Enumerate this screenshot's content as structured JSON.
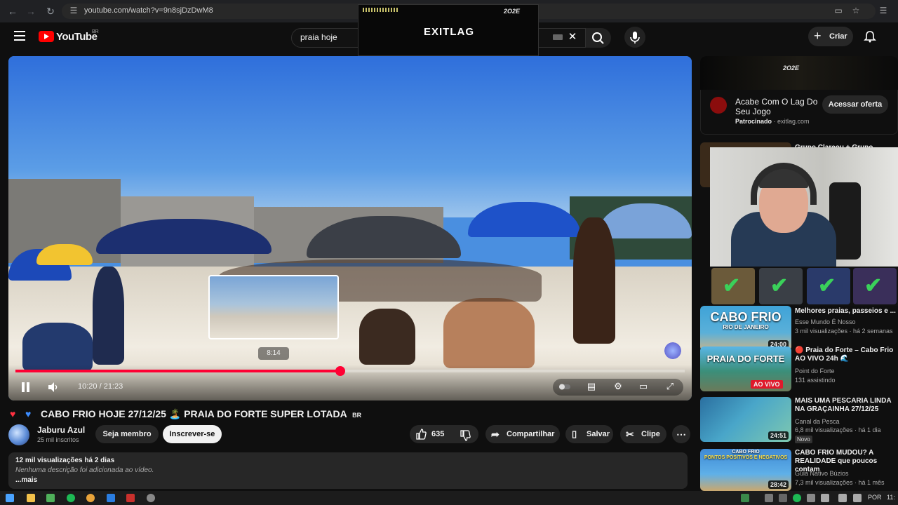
{
  "browser": {
    "url": "youtube.com/watch?v=9n8sjDzDwM8"
  },
  "overlay_ad": {
    "logo_text": "EXITLAG",
    "badge_text": "2O2E"
  },
  "header": {
    "logo_text": "YouTube",
    "country_code": "BR",
    "search_value": "praia hoje",
    "create_label": "Criar"
  },
  "player": {
    "preview_time": "8:14",
    "current_time": "10:20 / 21:23",
    "progress_fraction": 0.485,
    "buffer_fraction": 0.49
  },
  "video": {
    "title": "CABO FRIO HOJE 27/12/25 🏝️ PRAIA DO FORTE SUPER LOTADA",
    "title_suffix": "BR",
    "channel_name": "Jaburu Azul",
    "subscribers": "25 mil inscritos",
    "member_label": "Seja membro",
    "subscribe_label": "Inscrever-se",
    "likes": "635",
    "share_label": "Compartilhar",
    "save_label": "Salvar",
    "clip_label": "Clipe",
    "stats": "12 mil visualizações  há 2 dias",
    "description": "Nenhuma descrição foi adicionada ao vídeo.",
    "more_label": "...mais"
  },
  "sidebar_ad": {
    "banner_badge": "2O2E",
    "title": "Acabe Com O Lag Do Seu Jogo",
    "sponsored": "Patrocinado",
    "domain": "· exitlag.com",
    "cta": "Acessar oferta"
  },
  "recommendations": [
    {
      "title": "Grupo Clareou + Grupo",
      "channel": "",
      "stats": "",
      "duration": "",
      "caption": ""
    },
    {
      "title": "Melhores praias, passeios e ...",
      "channel": "Esse Mundo É Nosso",
      "stats": "3 mil visualizações · há 2 semanas",
      "duration": "24:00",
      "caption": "CABO FRIO",
      "subcaption": "RIO DE JANEIRO"
    },
    {
      "title": "🔴 Praia do Forte – Cabo Frio AO VIVO 24h 🌊",
      "channel": "Point do Forte",
      "stats": "131 assistindo",
      "duration": "",
      "caption": "PRAIA DO FORTE",
      "subcaption": "AO VIVO",
      "live_badge": "AO VIVO"
    },
    {
      "title": "MAIS UMA PESCARIA LINDA NA GRAÇAINHA 27/12/25",
      "channel": "Canal da Pesca",
      "stats": "6,8 mil visualizações · há 1 dia",
      "badge": "Novo",
      "duration": "24:51"
    },
    {
      "title": "CABO FRIO MUDOU? A REALIDADE que poucos contam",
      "channel": "Guia Nativo Búzios",
      "stats": "7,3 mil visualizações · há 1 mês",
      "duration": "28:42",
      "caption": "CABO FRIO",
      "subcaption": "PONTOS POSITIVOS E NEGATIVOS"
    }
  ],
  "taskbar": {
    "lang": "POR",
    "clock": "11:"
  },
  "colors": {
    "accent_red": "#ff0033",
    "bg": "#0f0f0f",
    "check_green": "#3ad15a"
  }
}
